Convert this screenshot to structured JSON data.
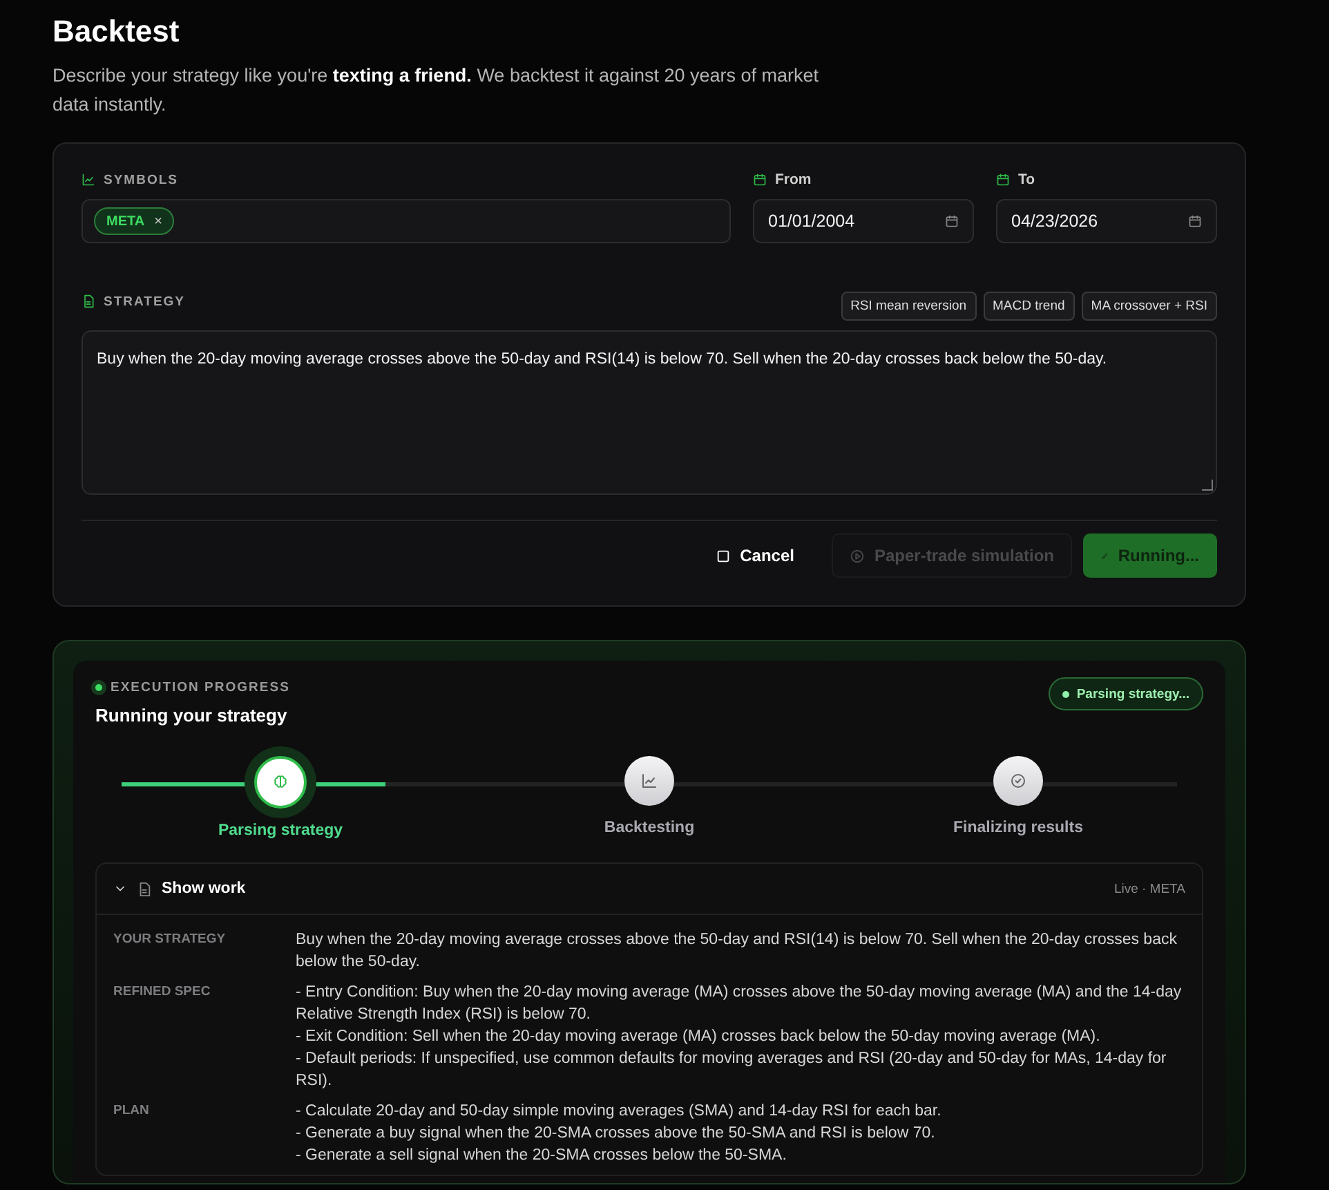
{
  "header": {
    "title": "Backtest",
    "subtitle": "Describe your strategy like you're **texting a friend.** We backtest it against 20 years of market data instantly."
  },
  "form": {
    "symbols": {
      "label": "SYMBOLS",
      "tags": [
        {
          "label": "META",
          "remove": "×"
        }
      ]
    },
    "from": {
      "label": "From",
      "value": "01/01/2004"
    },
    "to": {
      "label": "To",
      "value": "04/23/2026"
    },
    "strategy": {
      "label": "STRATEGY",
      "presets": [
        "RSI mean reversion",
        "MACD trend",
        "MA crossover + RSI"
      ],
      "value": "Buy when the 20-day moving average crosses above the 50-day and RSI(14) is below 70. Sell when the 20-day crosses back below the 50-day."
    },
    "buttons": [
      {
        "label": "Cancel",
        "kind": "ghost",
        "disabled": false
      },
      {
        "label": "Paper-trade simulation",
        "kind": "outline",
        "disabled": true
      },
      {
        "label": "Running...",
        "kind": "primary",
        "disabled": false
      }
    ]
  },
  "progress": {
    "eyebrow": "EXECUTION PROGRESS",
    "title": "Running your strategy",
    "status": "Parsing strategy...",
    "level": 0.25,
    "steps": [
      {
        "label": "Parsing strategy",
        "kind": "brain",
        "selected": true
      },
      {
        "label": "Backtesting",
        "kind": "chart",
        "selected": false
      },
      {
        "label": "Finalizing results",
        "kind": "check",
        "selected": false
      }
    ],
    "work": {
      "title": "Show work",
      "expanded": true,
      "meta": "Live · META",
      "rows": [
        {
          "label": "YOUR STRATEGY",
          "lines": [
            "Buy when the 20-day moving average crosses above the 50-day and RSI(14) is below 70. Sell when the 20-day crosses back below the 50-day."
          ]
        },
        {
          "label": "REFINED SPEC",
          "lines": [
            "- Entry Condition: Buy when the 20-day moving average (MA) crosses above the 50-day moving average (MA) and the 14-day Relative Strength Index (RSI) is below 70.",
            "- Exit Condition: Sell when the 20-day moving average (MA) crosses back below the 50-day moving average (MA).",
            "- Default periods: If unspecified, use common defaults for moving averages and RSI (20-day and 50-day for MAs, 14-day for RSI)."
          ]
        },
        {
          "label": "PLAN",
          "lines": [
            "- Calculate 20-day and 50-day simple moving averages (SMA) and 14-day RSI for each bar.",
            "- Generate a buy signal when the 20-SMA crosses above the 50-SMA and RSI is below 70.",
            "- Generate a sell signal when the 20-SMA crosses below the 50-SMA."
          ]
        }
      ]
    }
  }
}
